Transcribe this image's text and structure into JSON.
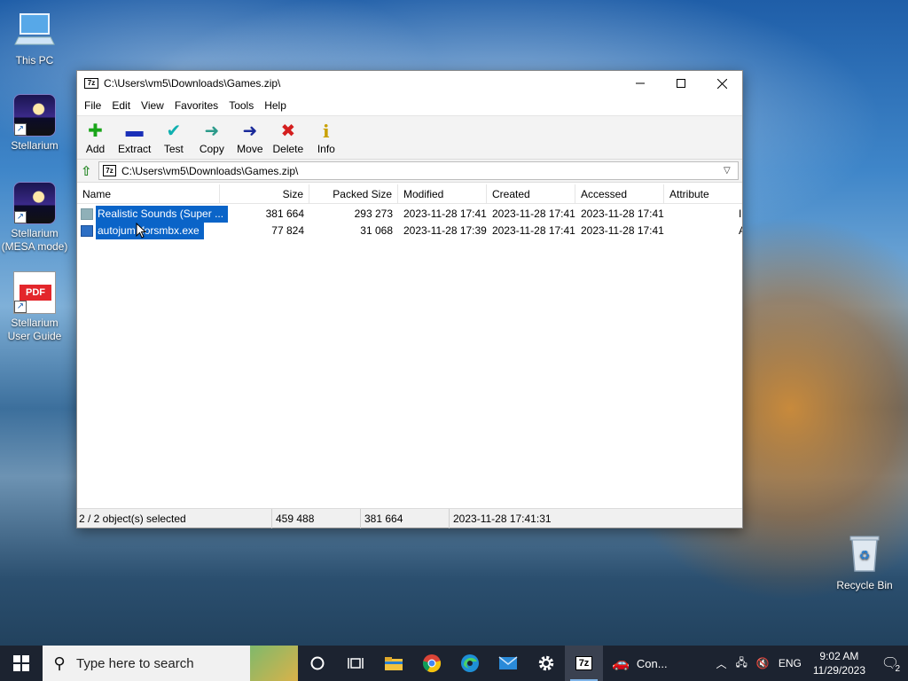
{
  "desktop": {
    "icons": [
      {
        "label": "This PC"
      },
      {
        "label": "Stellarium"
      },
      {
        "label": "Stellarium (MESA mode)"
      },
      {
        "label": "Stellarium User Guide"
      },
      {
        "label": "Recycle Bin"
      }
    ],
    "pdf_tag": "PDF"
  },
  "window": {
    "title": "C:\\Users\\vm5\\Downloads\\Games.zip\\",
    "app_badge": "7z",
    "menu": [
      "File",
      "Edit",
      "View",
      "Favorites",
      "Tools",
      "Help"
    ],
    "toolbar": [
      {
        "label": "Add",
        "icon": "add-icon",
        "glyph": "✚",
        "color": "#19a519"
      },
      {
        "label": "Extract",
        "icon": "extract-icon",
        "glyph": "▬",
        "color": "#1a2fb8"
      },
      {
        "label": "Test",
        "icon": "test-icon",
        "glyph": "✔",
        "color": "#10b0b0"
      },
      {
        "label": "Copy",
        "icon": "copy-icon",
        "glyph": "➜",
        "color": "#2b9a8a"
      },
      {
        "label": "Move",
        "icon": "move-icon",
        "glyph": "➜",
        "color": "#1a2a9a"
      },
      {
        "label": "Delete",
        "icon": "delete-icon",
        "glyph": "✖",
        "color": "#d41e1e"
      },
      {
        "label": "Info",
        "icon": "info-icon",
        "glyph": "i",
        "color": "#c9a000"
      }
    ],
    "address": "C:\\Users\\vm5\\Downloads\\Games.zip\\",
    "columns": [
      "Name",
      "Size",
      "Packed Size",
      "Modified",
      "Created",
      "Accessed",
      "Attribute"
    ],
    "rows": [
      {
        "name": "Realistic Sounds (Super ...",
        "size": "381 664",
        "packed": "293 273",
        "modified": "2023-11-28 17:41",
        "created": "2023-11-28 17:41",
        "accessed": "2023-11-28 17:41",
        "attr": "I",
        "icon": "file-icon"
      },
      {
        "name": "autojumpforsmbx.exe",
        "size": "77 824",
        "packed": "31 068",
        "modified": "2023-11-28 17:39",
        "created": "2023-11-28 17:41",
        "accessed": "2023-11-28 17:41",
        "attr": "A",
        "icon": "exe-icon"
      }
    ],
    "status": {
      "selected": "2 / 2 object(s) selected",
      "size": "459 488",
      "packed": "381 664",
      "date": "2023-11-28 17:41:31"
    }
  },
  "taskbar": {
    "search_placeholder": "Type here to search",
    "running_label": "Con...",
    "lang": "ENG",
    "time": "9:02 AM",
    "date": "11/29/2023",
    "notif_count": "2"
  }
}
